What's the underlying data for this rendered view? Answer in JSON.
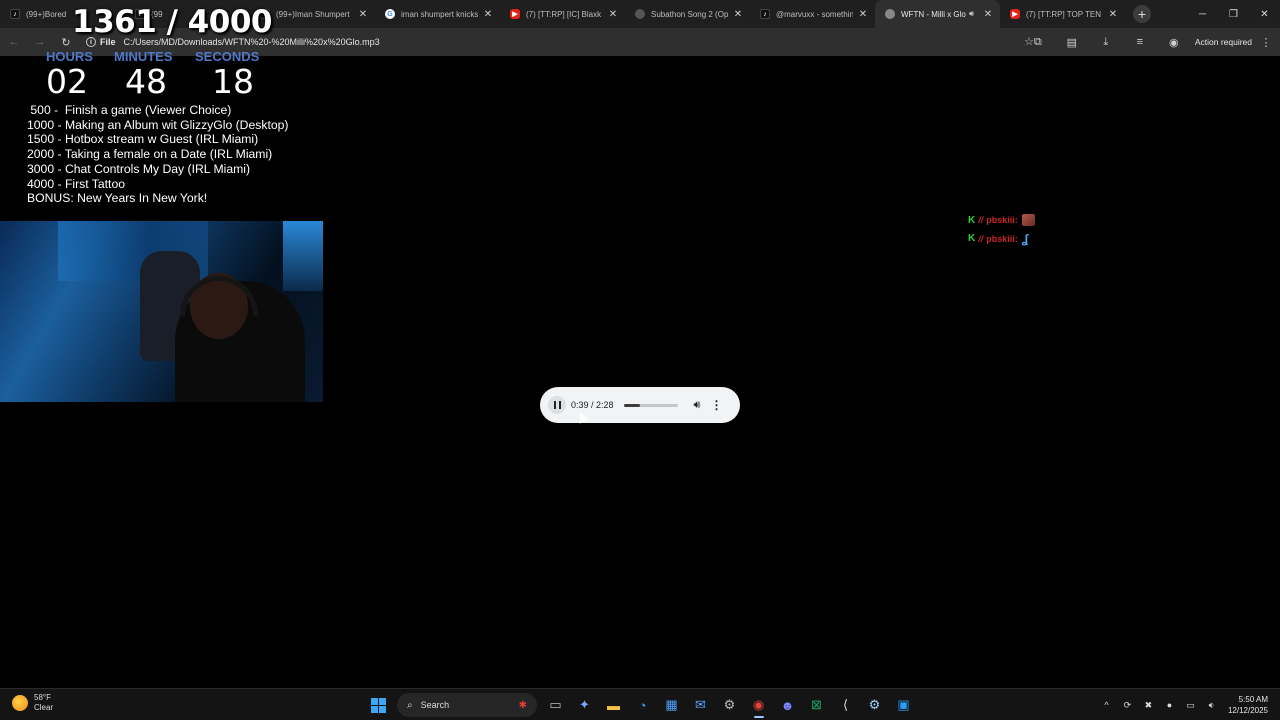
{
  "browser": {
    "tabs": [
      {
        "title": "(99+)Bored",
        "icon": "tiktok"
      },
      {
        "title": "(99",
        "icon": "tiktok"
      },
      {
        "title": "(99+)Iman Shumpert",
        "icon": "tiktok"
      },
      {
        "title": "iman shumpert knicks",
        "icon": "google"
      },
      {
        "title": "(7) [TT:RP] [IC] Blaxk",
        "icon": "youtube"
      },
      {
        "title": "Subathon Song 2 (Op",
        "icon": "globe"
      },
      {
        "title": "@marvuxx - somethin",
        "icon": "tiktok"
      },
      {
        "title": "WFTN - Milli x Glo",
        "icon": "audio",
        "active": true
      },
      {
        "title": "(7) [TT:RP] TOP TEN T",
        "icon": "youtube"
      }
    ],
    "omnibox": {
      "chip_label": "File",
      "url": "C:/Users/MD/Downloads/WFTN%20-%20Milli%20x%20Glo.mp3"
    },
    "action_required": "Action required"
  },
  "overlay": {
    "goal_counter": "1361 / 4000",
    "timer": {
      "hours_label": "HOURS",
      "hours": "02",
      "minutes_label": "MINUTES",
      "minutes": "48",
      "seconds_label": "SECONDS",
      "seconds": "18"
    },
    "goals": [
      " 500 -  Finish a game (Viewer Choice)",
      "1000 - Making an Album wit GlizzyGlo (Desktop)",
      "1500 - Hotbox stream w Guest (IRL Miami)",
      "2000 - Taking a female on a Date (IRL Miami)",
      "3000 - Chat Controls My Day (IRL Miami)",
      "4000 - First Tattoo",
      "BONUS: New Years In New York!"
    ],
    "chat": [
      {
        "badge": "K",
        "slash": "//",
        "user": "pbskiii:"
      },
      {
        "badge": "K",
        "slash": "//",
        "user": "pbskiii:"
      }
    ]
  },
  "player": {
    "time": "0:39 / 2:28",
    "progress": 0.3
  },
  "taskbar": {
    "weather_temp": "58°F",
    "weather_cond": "Clear",
    "search_label": "Search",
    "time": "5:50 AM",
    "date": "12/12/2025"
  }
}
